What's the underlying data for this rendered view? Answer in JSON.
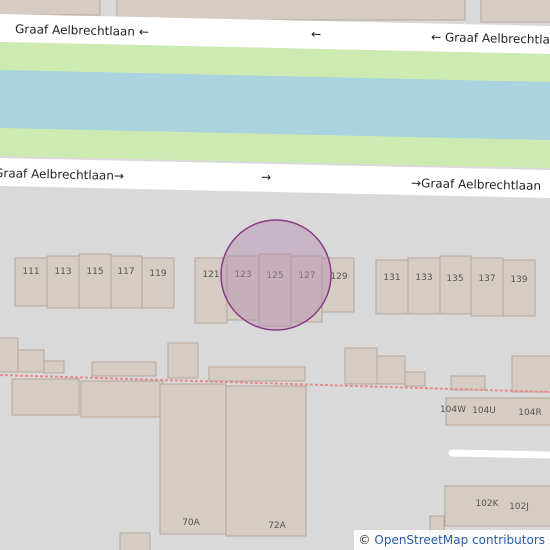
{
  "map": {
    "colors": {
      "background": "#d9d9d9",
      "road": "#ffffff",
      "grass": "#cdebb0",
      "water": "#aad3df",
      "building": "#d5ccc4",
      "building_outline": "#b6a79a",
      "highlight_fill": "#b48bb0",
      "highlight_stroke": "#8a3a88",
      "boundary": "#e88a8a"
    },
    "street_labels": {
      "north_left": "Graaf Aelbrechtlaan ←",
      "north_mid": "←",
      "north_right": "← Graaf Aelbrechtlaan",
      "south_left": "Graaf Aelbrechtlaan→",
      "south_mid": "→",
      "south_right": "→Graaf Aelbrechtlaan"
    },
    "house_numbers": {
      "n111": "111",
      "n113": "113",
      "n115": "115",
      "n117": "117",
      "n119": "119",
      "n121": "121",
      "n123": "123",
      "n125": "125",
      "n127": "127",
      "n129": "129",
      "n131": "131",
      "n133": "133",
      "n135": "135",
      "n137": "137",
      "n139": "139",
      "n104w": "104W",
      "n104u": "104U",
      "n104r": "104R",
      "n102k": "102K",
      "n102j": "102J",
      "n70a": "70A",
      "n72a": "72A"
    },
    "attribution": {
      "symbol": "©",
      "text": "OpenStreetMap contributors"
    }
  }
}
